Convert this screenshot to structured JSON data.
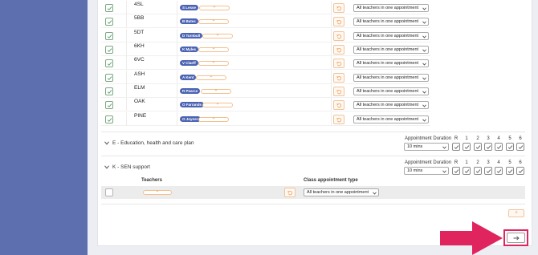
{
  "rows": [
    {
      "class": "4SL",
      "teacher": "S Lesse"
    },
    {
      "class": "5BB",
      "teacher": "B Bates"
    },
    {
      "class": "5DT",
      "teacher": "D Turnbull"
    },
    {
      "class": "6KH",
      "teacher": "K Myles"
    },
    {
      "class": "6VC",
      "teacher": "V Claeff"
    },
    {
      "class": "ASH",
      "teacher": "A Kent"
    },
    {
      "class": "ELM",
      "teacher": "R Pearce"
    },
    {
      "class": "OAK",
      "teacher": "O Farrands"
    },
    {
      "class": "PINE",
      "teacher": "O Joyner"
    }
  ],
  "appointment_type_value": "All teachers in one appointment",
  "sections": [
    {
      "title": "E - Education, health and care plan",
      "duration_label": "Appointment Duration",
      "duration_value": "10 mins"
    },
    {
      "title": "K - SEN support",
      "duration_label": "Appointment Duration",
      "duration_value": "10 mins"
    }
  ],
  "columns": [
    "R",
    "1",
    "2",
    "3",
    "4",
    "5",
    "6"
  ],
  "sen_table": {
    "teachers_header": "Teachers",
    "type_header": "Class appointment type",
    "type_value": "All teachers in one appointment"
  },
  "add_label": "+",
  "colors": {
    "sidebar": "#5d6fae",
    "accent_orange": "#f0c49b",
    "teacher_pill": "#4b63b3",
    "highlight": "#e0245e"
  }
}
